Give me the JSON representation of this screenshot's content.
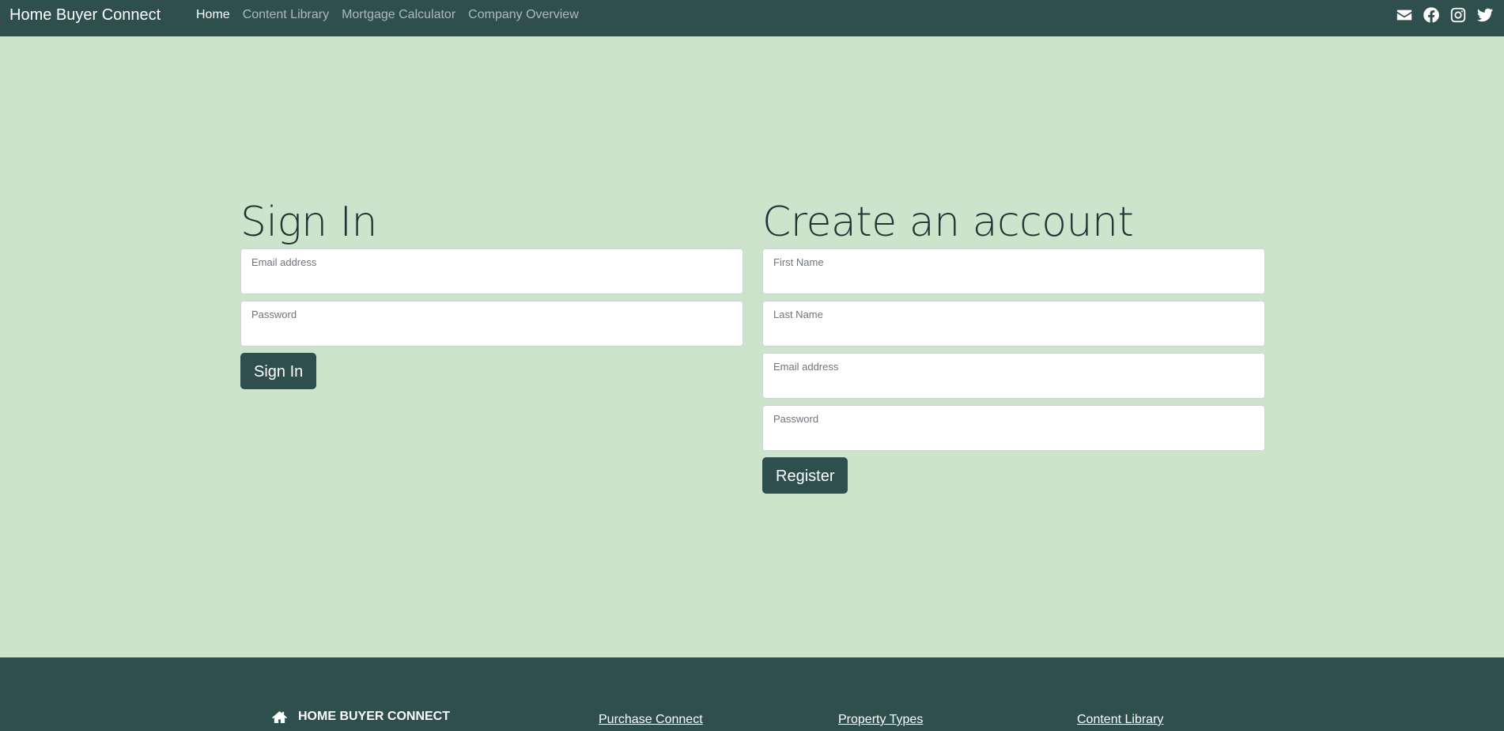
{
  "navbar": {
    "brand": "Home Buyer Connect",
    "links": [
      {
        "label": "Home",
        "active": true
      },
      {
        "label": "Content Library",
        "active": false
      },
      {
        "label": "Mortgage Calculator",
        "active": false
      },
      {
        "label": "Company Overview",
        "active": false
      }
    ],
    "social_icons": [
      "envelope-icon",
      "facebook-icon",
      "instagram-icon",
      "twitter-icon"
    ]
  },
  "signin": {
    "heading": "Sign In",
    "email_label": "Email address",
    "email_value": "",
    "password_label": "Password",
    "password_value": "",
    "button": "Sign In"
  },
  "register": {
    "heading": "Create an account",
    "first_name_label": "First Name",
    "first_name_value": "",
    "last_name_label": "Last Name",
    "last_name_value": "",
    "email_label": "Email address",
    "email_value": "",
    "password_label": "Password",
    "password_value": "",
    "button": "Register"
  },
  "footer": {
    "brand": "HOME BUYER CONNECT",
    "brand_icon": "home-icon",
    "links": [
      "Purchase Connect",
      "Property Types",
      "Content Library"
    ]
  },
  "colors": {
    "navbar_bg": "#2f4f4f",
    "page_bg": "#cbe4cb",
    "button_bg": "#2f4f4f"
  }
}
